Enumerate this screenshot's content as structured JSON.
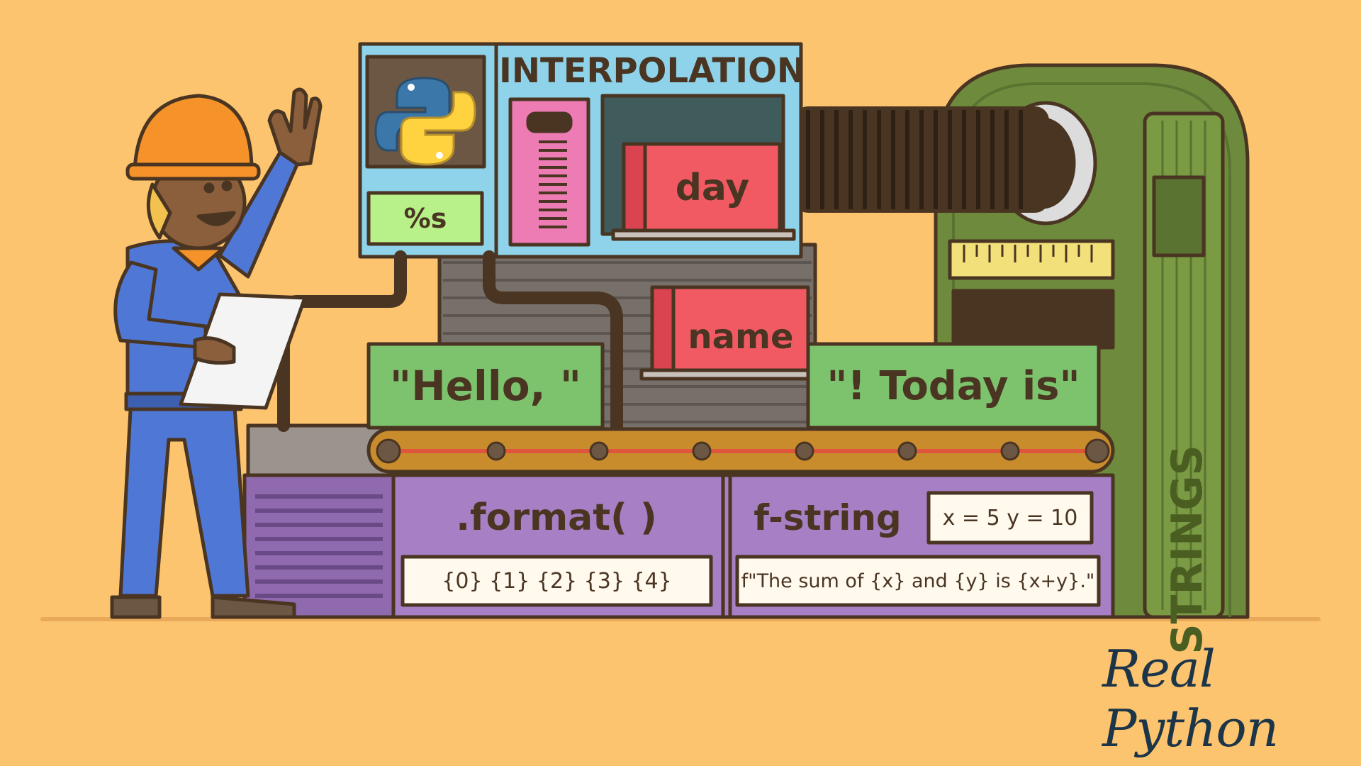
{
  "colors": {
    "background": "#FCC46F",
    "outline": "#4A3522",
    "machine_green": "#6E8B3D",
    "conveyor_purple": "#A67FC4",
    "label_green": "#7DC36E",
    "card_red": "#F25A63",
    "panel_blue": "#8ED3EA",
    "logo_navy": "#1D3548"
  },
  "icons": [
    "python-logo-icon",
    "worker-figure",
    "clipboard-icon",
    "ruler-icon",
    "spring-coil-icon"
  ],
  "labels": {
    "interpolation": "INTERPOLATION",
    "percent_s": "%s",
    "day": "day",
    "name": "name",
    "hello": "\"Hello, \"",
    "today": "\"! Today is\"",
    "format": ".format( )",
    "format_example": "{0} {1} {2} {3} {4}",
    "fstring": "f-string",
    "xy": "x = 5   y = 10",
    "fstring_example": "f\"The sum of {x} and {y} is {x+y}.\"",
    "strings": "STRINGS"
  },
  "logo": {
    "text": "Real Python"
  }
}
